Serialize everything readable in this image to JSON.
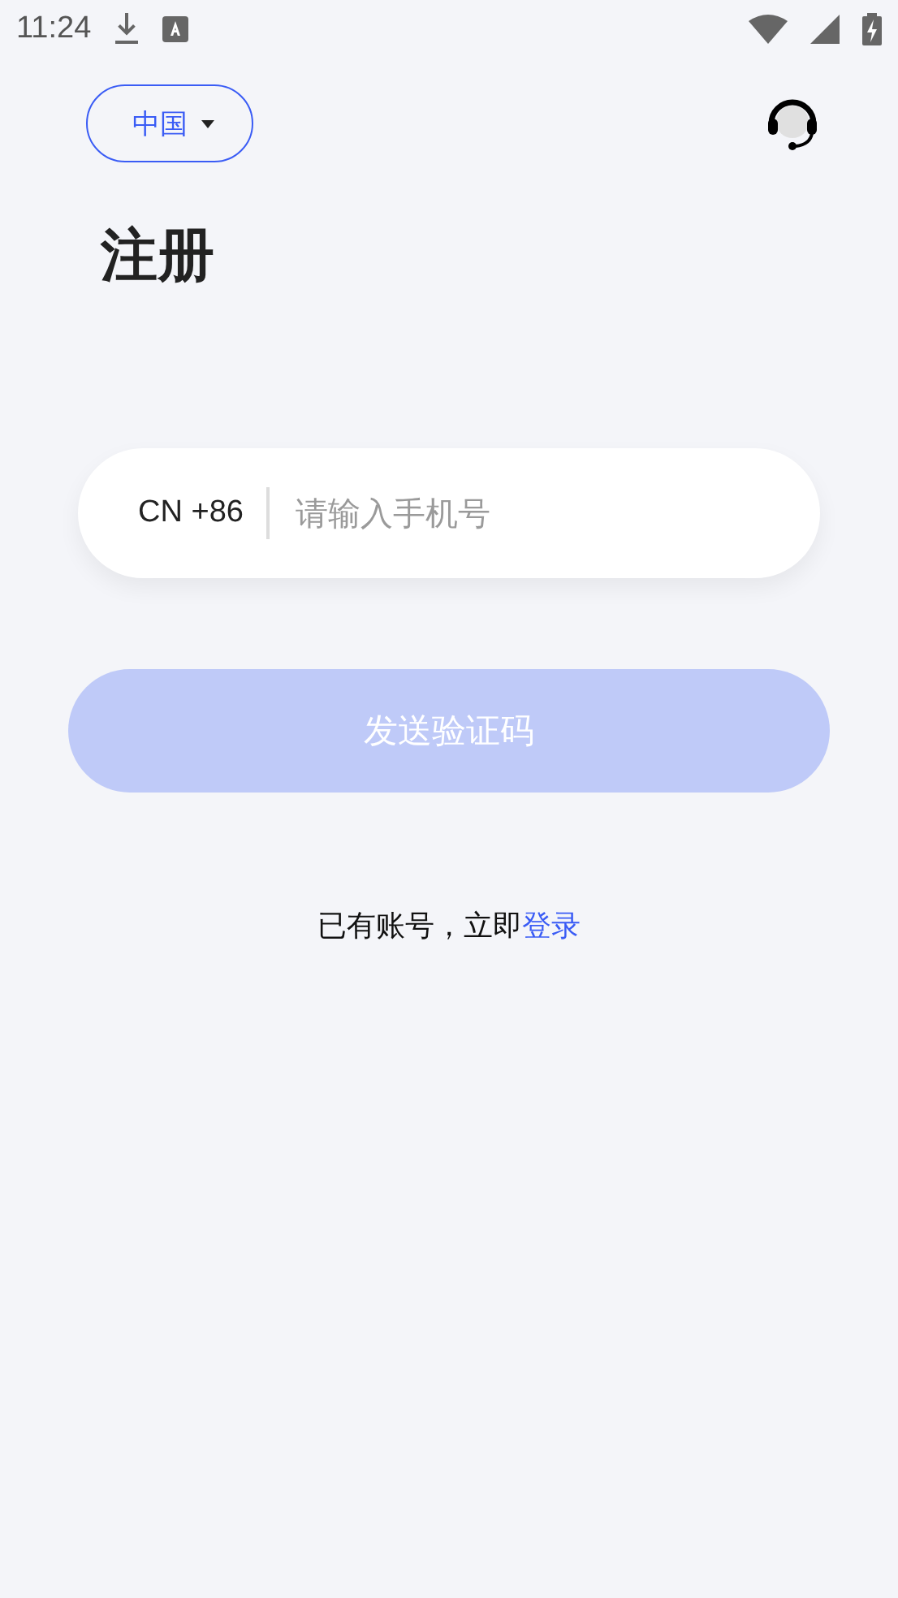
{
  "status_bar": {
    "time": "11:24"
  },
  "region": {
    "label": "中国"
  },
  "title": "注册",
  "phone": {
    "country_code": "CN +86",
    "placeholder": "请输入手机号"
  },
  "submit": {
    "label": "发送验证码",
    "disabled": true
  },
  "login_prompt": {
    "text": "已有账号，立即",
    "link": "登录"
  }
}
